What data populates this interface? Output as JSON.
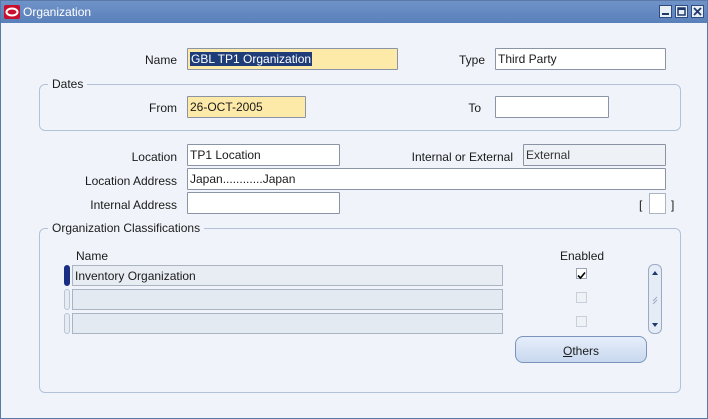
{
  "window": {
    "title": "Organization",
    "icons": {
      "app": "oracle-logo-icon",
      "minimize": "minimize-icon",
      "maximize": "maximize-icon",
      "close": "close-icon"
    }
  },
  "form": {
    "name_label": "Name",
    "name_value": "GBL TP1 Organization",
    "type_label": "Type",
    "type_value": "Third Party",
    "dates_group": "Dates",
    "from_label": "From",
    "from_value": "26-OCT-2005",
    "to_label": "To",
    "to_value": "",
    "location_label": "Location",
    "location_value": "TP1 Location",
    "internal_external_label": "Internal or External",
    "internal_external_value": "External",
    "location_address_label": "Location Address",
    "location_address_value": "Japan............Japan",
    "internal_address_label": "Internal Address",
    "internal_address_value": "",
    "bracket_open": "[",
    "bracket_close": "]"
  },
  "classifications": {
    "group_title": "Organization Classifications",
    "name_header": "Name",
    "enabled_header": "Enabled",
    "rows": [
      {
        "name": "Inventory Organization",
        "enabled": true
      },
      {
        "name": "",
        "enabled": false
      },
      {
        "name": "",
        "enabled": false
      }
    ],
    "others_button": "Others",
    "others_mnemonic": "O",
    "others_rest": "thers"
  },
  "colors": {
    "titlebar": "#5a80bb",
    "required_field": "#fdeaa8",
    "current_row_indicator": "#1a2e84",
    "canvas": "#f0f4fa"
  }
}
